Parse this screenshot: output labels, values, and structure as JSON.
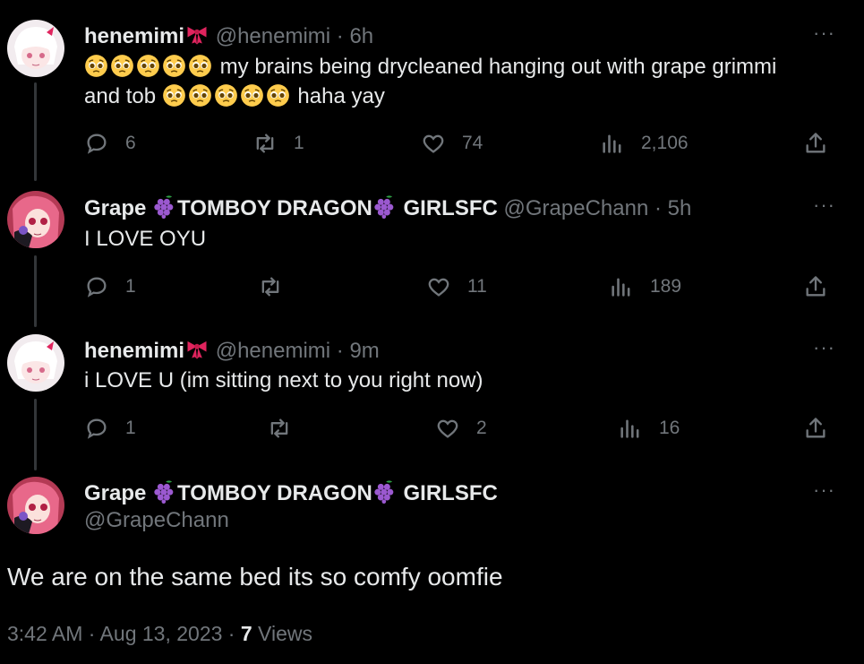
{
  "colors": {
    "background": "#000000",
    "text": "#e7e9ea",
    "muted": "#71767b",
    "bow": "#e0245e",
    "grape": "#9b59d0",
    "leaf": "#2e9e44"
  },
  "tweets": [
    {
      "name": "henemimi",
      "name_emoji": "ribbon-icon",
      "handle": "@henemimi",
      "time": "· 6h",
      "text_prefix_emojis": "pleading-face x5",
      "text_line1": "my brains being drycleaned hanging out with grape grimmi",
      "text_line2_start": "and tob",
      "text_line2_end": "haha yay",
      "replies": "6",
      "retweets": "1",
      "likes": "74",
      "views": "2,106"
    },
    {
      "name_part1": "Grape",
      "name_part2": "TOMBOY DRAGON",
      "name_part3": "GIRLSFC",
      "handle": "@GrapeChann",
      "time": "· 5h",
      "text": "I LOVE OYU",
      "replies": "1",
      "retweets": "",
      "likes": "11",
      "views": "189"
    },
    {
      "name": "henemimi",
      "handle": "@henemimi",
      "time": "· 9m",
      "text": "i LOVE U (im sitting next to you right now)",
      "replies": "1",
      "retweets": "",
      "likes": "2",
      "views": "16"
    }
  ],
  "main_tweet": {
    "name_part1": "Grape",
    "name_part2": "TOMBOY DRAGON",
    "name_part3": "GIRLSFC",
    "handle": "@GrapeChann",
    "text": "We are on the same bed its so comfy oomfie",
    "timestamp": "3:42 AM · Aug 13, 2023 ·",
    "views_count": "7",
    "views_label": "Views"
  },
  "more_label": "···"
}
